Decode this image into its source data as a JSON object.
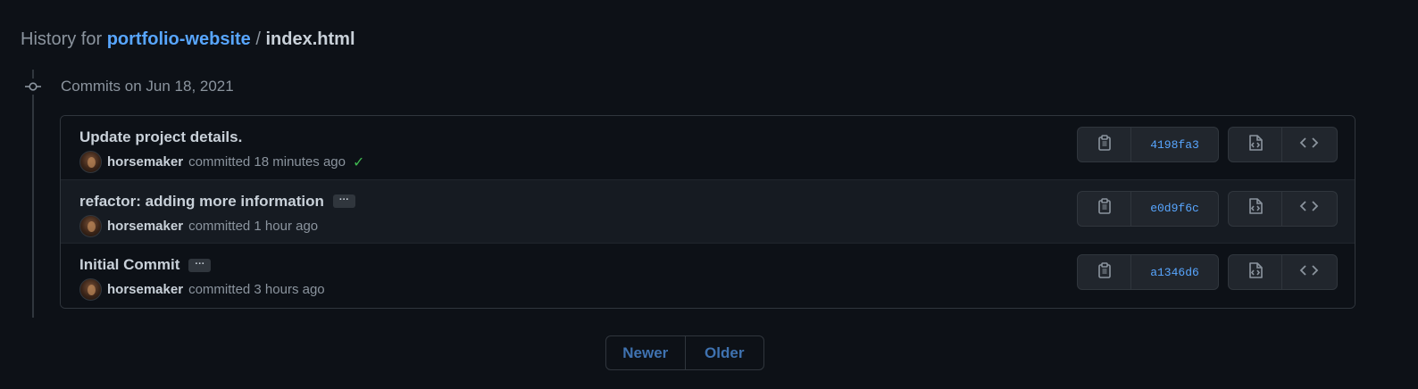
{
  "header": {
    "prefix": "History for",
    "repo": "portfolio-website",
    "separator": "/",
    "file": "index.html"
  },
  "group": {
    "title": "Commits on Jun 18, 2021"
  },
  "commits": [
    {
      "message": "Update project details.",
      "author": "horsemaker",
      "action": "committed 18 minutes ago",
      "sha": "4198fa3",
      "has_more": false,
      "status_check": "✓"
    },
    {
      "message": "refactor: adding more information",
      "author": "horsemaker",
      "action": "committed 1 hour ago",
      "sha": "e0d9f6c",
      "has_more": true,
      "more_label": "···"
    },
    {
      "message": "Initial Commit",
      "author": "horsemaker",
      "action": "committed 3 hours ago",
      "sha": "a1346d6",
      "has_more": true,
      "more_label": "···"
    }
  ],
  "pagination": {
    "newer": "Newer",
    "older": "Older"
  },
  "colors": {
    "background": "#0d1117",
    "link": "#58a6ff",
    "success": "#3fb950",
    "border": "#30363d"
  },
  "icons": {
    "timeline": "git-commit-icon",
    "copy": "clipboard-icon",
    "browse": "file-code-icon",
    "code": "code-icon"
  }
}
